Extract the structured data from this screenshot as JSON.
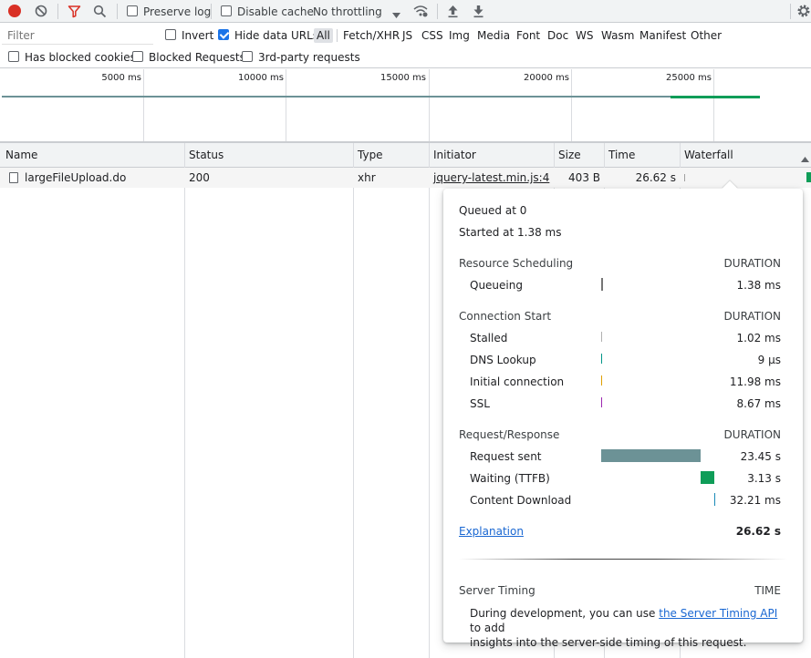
{
  "toolbar": {
    "preserve_log": "Preserve log",
    "disable_cache": "Disable cache",
    "throttling": "No throttling"
  },
  "filter_bar": {
    "placeholder": "Filter",
    "invert": "Invert",
    "hide_data_urls": "Hide data URLs",
    "types": [
      "All",
      "Fetch/XHR",
      "JS",
      "CSS",
      "Img",
      "Media",
      "Font",
      "Doc",
      "WS",
      "Wasm",
      "Manifest",
      "Other"
    ]
  },
  "options_bar": {
    "blocked_cookies": "Has blocked cookies",
    "blocked_requests": "Blocked Requests",
    "third_party": "3rd-party requests"
  },
  "overview": {
    "ticks": [
      "5000 ms",
      "10000 ms",
      "15000 ms",
      "20000 ms",
      "25000 ms"
    ]
  },
  "table": {
    "columns": [
      "Name",
      "Status",
      "Type",
      "Initiator",
      "Size",
      "Time",
      "Waterfall"
    ],
    "rows": [
      {
        "name": "largeFileUpload.do",
        "status": "200",
        "type": "xhr",
        "initiator": "jquery-latest.min.js:4",
        "size": "403 B",
        "time": "26.62 s"
      }
    ]
  },
  "timing": {
    "queued_at": "Queued at 0",
    "started_at": "Started at 1.38 ms",
    "duration_label": "DURATION",
    "sections": {
      "scheduling": {
        "title": "Resource Scheduling",
        "rows": [
          {
            "label": "Queueing",
            "value": "1.38 ms"
          }
        ]
      },
      "connection": {
        "title": "Connection Start",
        "rows": [
          {
            "label": "Stalled",
            "value": "1.02 ms"
          },
          {
            "label": "DNS Lookup",
            "value": "9 µs"
          },
          {
            "label": "Initial connection",
            "value": "11.98 ms"
          },
          {
            "label": "SSL",
            "value": "8.67 ms"
          }
        ]
      },
      "request": {
        "title": "Request/Response",
        "rows": [
          {
            "label": "Request sent",
            "value": "23.45 s"
          },
          {
            "label": "Waiting (TTFB)",
            "value": "3.13 s"
          },
          {
            "label": "Content Download",
            "value": "32.21 ms"
          }
        ]
      }
    },
    "explanation": "Explanation",
    "total": "26.62 s",
    "server_timing": {
      "title": "Server Timing",
      "time_label": "TIME",
      "note_before": "During development, you can use ",
      "note_link": "the Server Timing API",
      "note_after": " to add",
      "note_line2": "insights into the server-side timing of this request."
    }
  },
  "colors": {
    "record": "#d93025",
    "request_sent": "#6c9296",
    "waiting": "#0f9d58",
    "download": "#1a8ab7"
  }
}
